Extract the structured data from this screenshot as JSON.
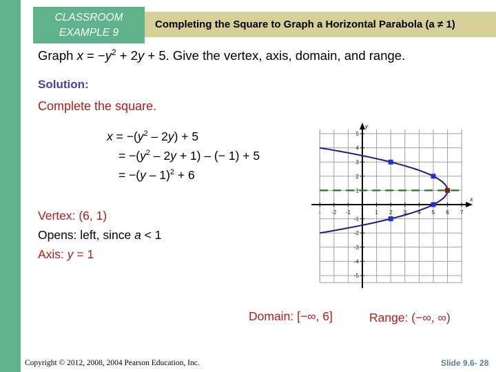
{
  "header": {
    "example_label_line1": "CLASSROOM",
    "example_label_line2": "EXAMPLE 9",
    "title": "Completing the Square to Graph a Horizontal Parabola (a ≠ 1)"
  },
  "problem": {
    "prefix": "Graph ",
    "var_x": "x",
    "eq_mid": " = −",
    "var_y": "y",
    "exp": "2",
    "tail": " + 2",
    "var_y2": "y",
    "tail2": " + 5.  Give the vertex, axis, domain, and range."
  },
  "solution_label": "Solution:",
  "complete_label": "Complete the square.",
  "steps": {
    "line1": {
      "x": "x",
      "a": " = −(",
      "y": "y",
      "exp": "2",
      "b": " – 2",
      "y2": "y",
      "c": ") + 5"
    },
    "line2": {
      "a": "= −(",
      "y": "y",
      "exp": "2",
      "b": " – 2",
      "y2": "y",
      "c": " + 1) – (− 1) + 5"
    },
    "line3": {
      "a": "= −(",
      "y": "y",
      "b": " – 1)",
      "exp": "2",
      "c": " + 6"
    }
  },
  "results": {
    "vertex": "Vertex:  (6, 1)",
    "opens_prefix": "Opens:  left,  since ",
    "opens_var": "a",
    "opens_suffix": " < 1",
    "axis_prefix": "Axis:  ",
    "axis_var": "y",
    "axis_suffix": " = 1",
    "domain": "Domain: [−∞, 6]",
    "range": "Range: (−∞, ∞)"
  },
  "footer": {
    "copyright": "Copyright © 2012, 2008, 2004  Pearson Education, Inc.",
    "slide": "Slide 9.6- 28"
  },
  "colors": {
    "green_accent": "#5fb38a",
    "title_bar": "#d7cf98",
    "curve": "#1a1a8c",
    "points": "#1f2fd6",
    "vertex_point": "#7a1f1f",
    "axis_of_symmetry": "#1e7a1e",
    "red_text": "#b51b1b",
    "solution_text": "#4a3fa0"
  },
  "chart_data": {
    "type": "line",
    "title": "",
    "equation": "x = -(y - 1)^2 + 6",
    "xlabel": "x",
    "ylabel": "y",
    "xlim": [
      -3,
      7
    ],
    "ylim": [
      -5.5,
      5.3
    ],
    "grid": true,
    "x_ticks": [
      -3,
      -2,
      -1,
      1,
      2,
      3,
      4,
      5,
      6,
      7
    ],
    "x_tick_labels": [
      "-",
      "-2",
      "-1",
      "1",
      "2",
      "3",
      "4",
      "5",
      "6",
      "7"
    ],
    "y_ticks": [
      5,
      4,
      3,
      2,
      1,
      -1,
      -2,
      -3,
      -4,
      -5
    ],
    "y_tick_labels": [
      "5",
      "4",
      "3",
      "2",
      "1",
      "-1",
      "-2",
      "-3",
      "-4",
      "-5"
    ],
    "series": [
      {
        "name": "parabola",
        "points": [
          [
            2,
            3
          ],
          [
            5,
            2
          ],
          [
            6,
            1
          ],
          [
            5,
            0
          ],
          [
            2,
            -1
          ]
        ],
        "vertex": [
          6,
          1
        ]
      },
      {
        "name": "axis of symmetry",
        "equation": "y = 1",
        "style": "dashed"
      }
    ]
  }
}
